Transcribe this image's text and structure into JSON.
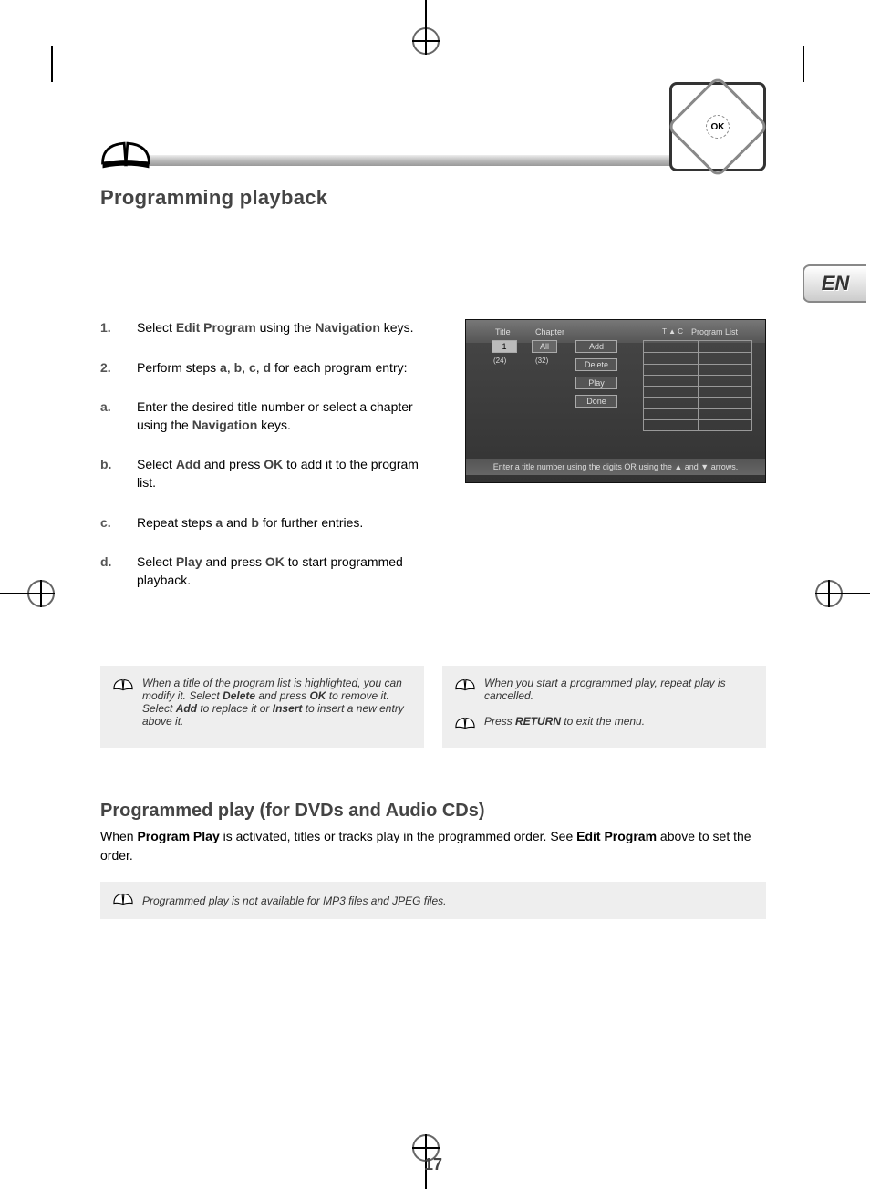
{
  "header": {
    "title": "Programming playback",
    "ok_label": "OK",
    "lang_tab": "EN"
  },
  "steps": [
    {
      "num": "1.",
      "parts": [
        "Select ",
        "Edit Program",
        " using the ",
        "Navigation",
        " keys."
      ]
    },
    {
      "num": "2.",
      "parts": [
        "Perform steps ",
        "a",
        ", ",
        "b",
        ", ",
        "c",
        ", ",
        "d",
        " for each program entry:"
      ]
    },
    {
      "num": "a.",
      "parts": [
        "Enter the desired title number or select a chapter using the ",
        "Navigation",
        " keys."
      ]
    },
    {
      "num": "b.",
      "parts": [
        "Select ",
        "Add",
        " and press ",
        "OK",
        " to add it to the program list."
      ]
    },
    {
      "num": "c.",
      "parts": [
        "Repeat steps ",
        "a",
        " and ",
        "b",
        " for further entries."
      ]
    },
    {
      "num": "d.",
      "parts": [
        "Select ",
        "Play",
        " and press ",
        "OK",
        " to start programmed playback."
      ]
    }
  ],
  "osd": {
    "title_hdr": "Title",
    "chapter_hdr": "Chapter",
    "program_list_hdr": "Program List",
    "tc": "T   ▲   C",
    "title_val": "1",
    "chapter_val": "All",
    "title_total": "(24)",
    "chapter_total": "(32)",
    "buttons": [
      "Add",
      "Delete",
      "Play",
      "Done"
    ],
    "footer": "Enter a title number using the digits OR using the ▲ and ▼ arrows."
  },
  "note1": {
    "text_parts": [
      "When a title of the program list is highlighted, you can modify it. Select ",
      "Delete",
      " and press ",
      "OK",
      " to remove it. Select ",
      "Add",
      " to replace it or ",
      "Insert",
      " to insert a new entry above it."
    ]
  },
  "note2a": {
    "text": "When you start a programmed play, repeat play is cancelled."
  },
  "note2b": {
    "text_parts": [
      "Press ",
      "RETURN",
      " to exit the menu."
    ]
  },
  "section2": {
    "heading": "Programmed play (for DVDs and Audio CDs)",
    "body_parts": [
      "When ",
      "Program Play",
      " is activated, titles or tracks play in the programmed order. See ",
      "Edit Program",
      " above to set the order."
    ]
  },
  "note_wide": {
    "text": "Programmed play is not available for MP3 files and JPEG files."
  },
  "page_number": "17"
}
